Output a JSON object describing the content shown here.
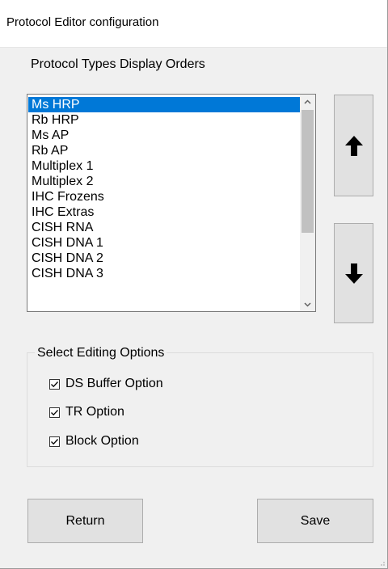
{
  "window": {
    "title": "Protocol Editor configuration"
  },
  "protocol_list": {
    "label": "Protocol Types Display Orders",
    "selected_index": 0,
    "items": [
      "Ms HRP",
      "Rb HRP",
      "Ms AP",
      "Rb AP",
      "Multiplex 1",
      "Multiplex 2",
      "IHC Frozens",
      "IHC Extras",
      "CISH RNA",
      "CISH DNA 1",
      "CISH DNA 2",
      "CISH DNA 3"
    ]
  },
  "move_buttons": {
    "up_icon": "arrow-up-icon",
    "down_icon": "arrow-down-icon"
  },
  "editing_options": {
    "label": "Select Editing Options",
    "options": [
      {
        "label": "DS Buffer Option",
        "checked": true
      },
      {
        "label": "TR Option",
        "checked": true
      },
      {
        "label": "Block Option",
        "checked": true
      }
    ]
  },
  "buttons": {
    "return_label": "Return",
    "save_label": "Save"
  },
  "colors": {
    "selection": "#0078d7",
    "button_face": "#e1e1e1",
    "window_bg": "#f0f0f0"
  }
}
